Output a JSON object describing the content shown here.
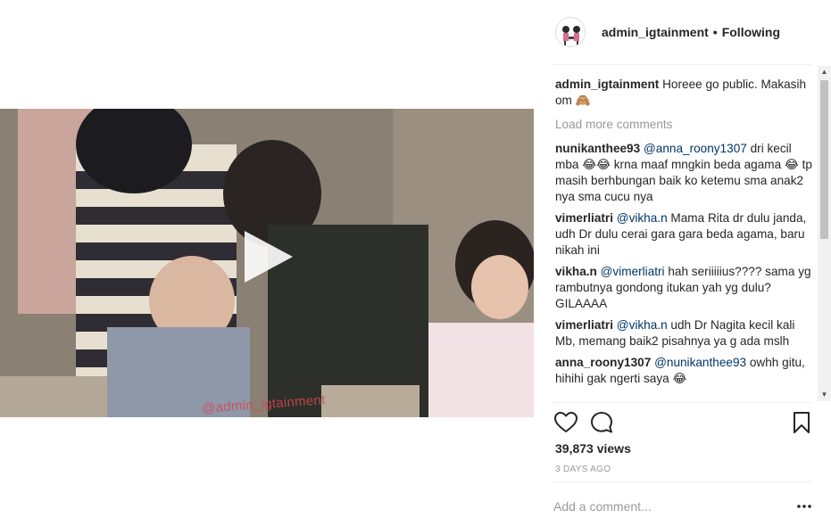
{
  "post": {
    "username": "admin_igtainment",
    "separator": "•",
    "follow_state": "Following"
  },
  "caption": {
    "username": "admin_igtainment",
    "text": "Horeee go public. Makasih om 🙈"
  },
  "load_more": "Load more comments",
  "comments": [
    {
      "user": "nunikanthee93",
      "mention": "@anna_roony1307",
      "text": " dri kecil mba 😂😂 krna maaf mngkin beda agama 😂 tp masih berhbungan baik ko ketemu sma anak2 nya sma cucu nya"
    },
    {
      "user": "vimerliatri",
      "mention": "@vikha.n",
      "text": " Mama Rita dr dulu janda, udh Dr dulu cerai gara gara beda agama, baru nikah ini"
    },
    {
      "user": "vikha.n",
      "mention": "@vimerliatri",
      "text": " hah seriiiiius???? sama yg rambutnya gondong itukan yah yg dulu? GILAAAA"
    },
    {
      "user": "vimerliatri",
      "mention": "@vikha.n",
      "text": " udh Dr Nagita kecil kali Mb, memang baik2 pisahnya ya g ada mslh"
    },
    {
      "user": "anna_roony1307",
      "mention": "@nunikanthee93",
      "text": " owhh gitu, hihihi gak ngerti saya 😂"
    }
  ],
  "stats": {
    "views_count": "39,873",
    "views_label": " views",
    "timestamp": "3 DAYS AGO"
  },
  "add_comment": {
    "placeholder": "Add a comment..."
  },
  "video": {
    "watermark": "@admin_igtainment"
  },
  "icons": {
    "like": "heart-icon",
    "comment": "comment-icon",
    "save": "bookmark-icon",
    "play": "play-icon",
    "more": "more-options-icon"
  },
  "colors": {
    "text": "#262626",
    "muted": "#999999",
    "mention": "#003569",
    "divider": "#efefef"
  }
}
